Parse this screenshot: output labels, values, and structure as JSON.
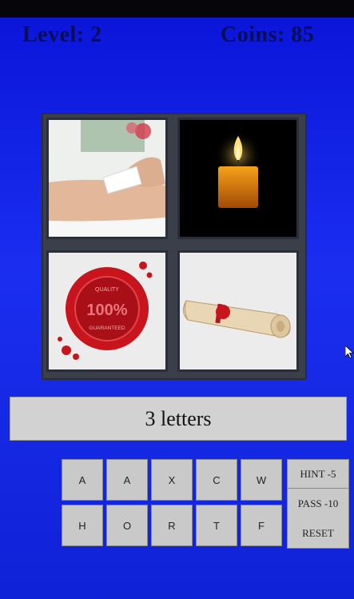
{
  "hud": {
    "level": "Level: 2",
    "coins": "Coins: 85"
  },
  "puzzle": {
    "hint_text": "3 letters",
    "images": [
      "waxing-strip-on-arm",
      "lit-candle",
      "red-wax-seal-quality-100-percent",
      "scroll-with-wax-seal"
    ],
    "seal_text": {
      "top": "QUALITY",
      "center": "100%",
      "bottom": "GUARANTEED"
    }
  },
  "keys": {
    "row1": [
      "A",
      "A",
      "X",
      "C",
      "W"
    ],
    "row2": [
      "H",
      "O",
      "R",
      "T",
      "F"
    ]
  },
  "actions": {
    "hint": "HINT -5",
    "pass": "PASS -10",
    "reset": "RESET"
  },
  "colors": {
    "background": "#1a2ef0",
    "hud_text": "#0a0f55",
    "tile_frame": "#3a3f4a",
    "seal_red": "#c8141c"
  }
}
